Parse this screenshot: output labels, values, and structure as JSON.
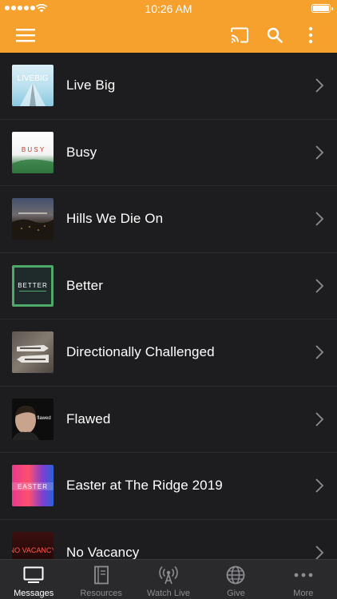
{
  "status": {
    "time": "10:26 AM"
  },
  "list": {
    "items": [
      {
        "title": "Live Big",
        "art_text": "LIVEBIG"
      },
      {
        "title": "Busy",
        "art_text": "B U S Y"
      },
      {
        "title": "Hills We Die On",
        "art_text": ""
      },
      {
        "title": "Better",
        "art_text": "BETTER"
      },
      {
        "title": "Directionally Challenged",
        "art_text": ""
      },
      {
        "title": "Flawed",
        "art_text": "flawed"
      },
      {
        "title": "Easter at The Ridge 2019",
        "art_text": "EASTER"
      },
      {
        "title": "No Vacancy",
        "art_text": "NO VACANCY"
      }
    ]
  },
  "tabs": [
    {
      "label": "Messages",
      "icon": "tv-icon",
      "active": true
    },
    {
      "label": "Resources",
      "icon": "book-icon"
    },
    {
      "label": "Watch Live",
      "icon": "broadcast-icon"
    },
    {
      "label": "Give",
      "icon": "globe-icon"
    },
    {
      "label": "More",
      "icon": "ellipsis-icon"
    }
  ],
  "colors": {
    "accent": "#f6a02e",
    "background": "#1d1d1f",
    "tabbar": "#2a2a2c"
  }
}
